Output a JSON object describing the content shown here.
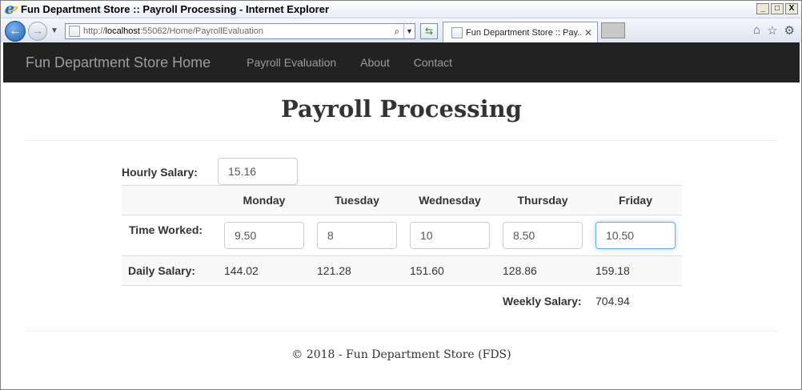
{
  "browser": {
    "window_title": "Fun Department Store :: Payroll Processing - Internet Explorer",
    "url_prefix": "http://",
    "url_host": "localhost",
    "url_rest": ":55062/Home/PayrollEvaluation",
    "tab_title": "Fun Department Store :: Pay...",
    "buttons": {
      "minimize": "_",
      "maximize": "□",
      "close": "X"
    }
  },
  "navbar": {
    "brand": "Fun Department Store Home",
    "links": [
      "Payroll Evaluation",
      "About",
      "Contact"
    ]
  },
  "page": {
    "title": "Payroll Processing",
    "hourly_label": "Hourly Salary:",
    "hourly_value": "15.16",
    "days": [
      "Monday",
      "Tuesday",
      "Wednesday",
      "Thursday",
      "Friday"
    ],
    "time_label": "Time Worked:",
    "time_values": [
      "9.50",
      "8",
      "10",
      "8.50",
      "10.50"
    ],
    "daily_label": "Daily Salary:",
    "daily_values": [
      "144.02",
      "121.28",
      "151.60",
      "128.86",
      "159.18"
    ],
    "weekly_label": "Weekly Salary:",
    "weekly_value": "704.94"
  },
  "footer": {
    "text": "© 2018 - Fun Department Store (FDS)"
  }
}
